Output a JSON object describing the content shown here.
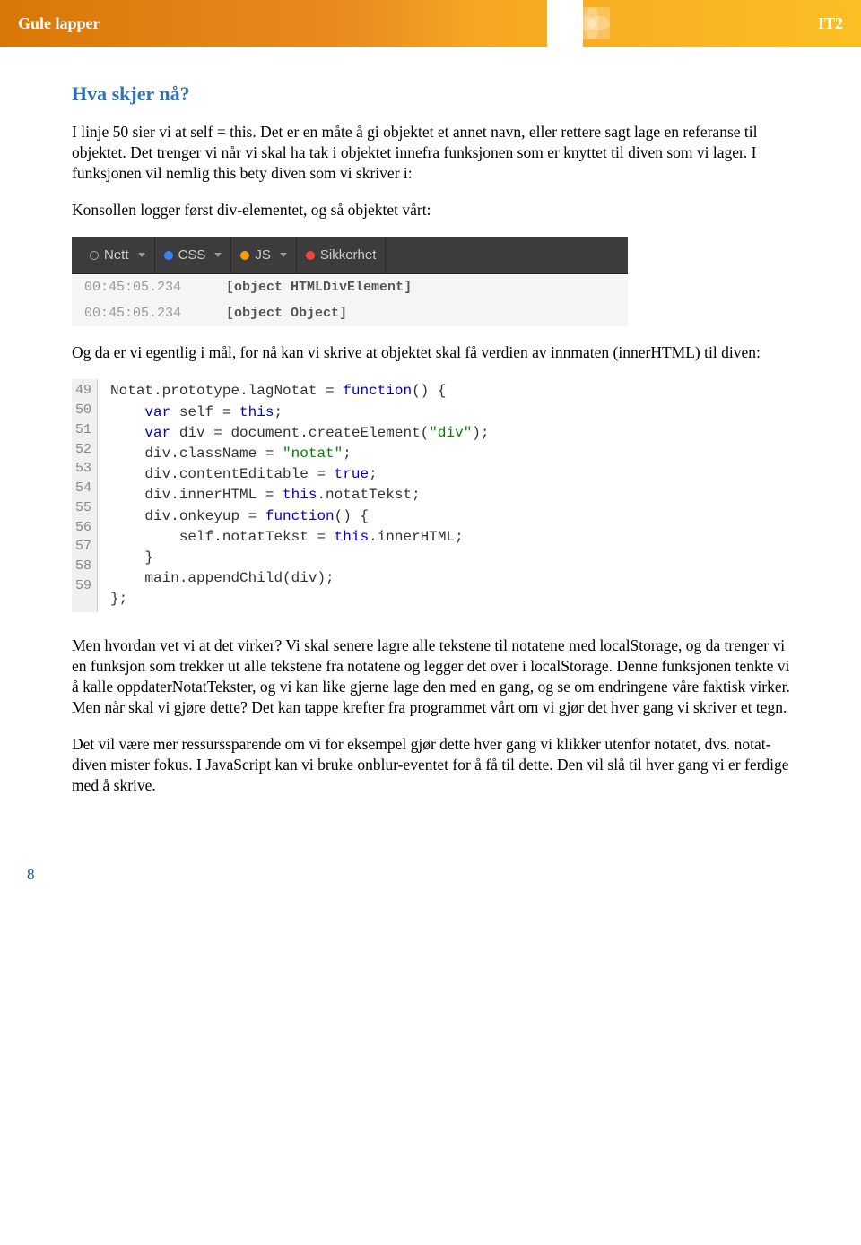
{
  "header": {
    "left": "Gule lapper",
    "right": "IT2"
  },
  "heading": "Hva skjer nå?",
  "para1": "I linje 50 sier vi at self = this. Det er en måte å gi objektet et annet navn, eller rettere sagt lage en referanse til objektet. Det trenger vi når vi skal ha tak i objektet innefra funksjonen som er knyttet til diven som vi lager. I funksjonen vil nemlig this bety diven som vi skriver i:",
  "para2": "Konsollen logger først div-elementet, og så objektet vårt:",
  "console": {
    "tabs": {
      "nett": "Nett",
      "css": "CSS",
      "js": "JS",
      "sikkerhet": "Sikkerhet"
    },
    "rows": [
      {
        "ts": "00:45:05.234",
        "msg": "[object HTMLDivElement]"
      },
      {
        "ts": "00:45:05.234",
        "msg": "[object Object]"
      }
    ]
  },
  "para3": "Og da er vi egentlig i mål, for nå kan vi skrive at objektet skal få verdien av innmaten (innerHTML) til diven:",
  "code": {
    "gutter": "49\n50\n51\n52\n53\n54\n55\n56\n57\n58\n59",
    "l49a": "Notat.prototype.lagNotat = ",
    "l49kw": "function",
    "l49b": "() {",
    "l50kw": "var",
    "l50a": " self = ",
    "l50kw2": "this",
    "l50b": ";",
    "l51kw": "var",
    "l51a": " div = document.createElement(",
    "l51s": "\"div\"",
    "l51b": ");",
    "l52a": "div.className = ",
    "l52s": "\"notat\"",
    "l52b": ";",
    "l53a": "div.contentEditable = ",
    "l53kw": "true",
    "l53b": ";",
    "l54a": "div.innerHTML = ",
    "l54kw": "this",
    "l54b": ".notatTekst;",
    "l55a": "div.onkeyup = ",
    "l55kw": "function",
    "l55b": "() {",
    "l56a": "self.notatTekst = ",
    "l56kw": "this",
    "l56b": ".innerHTML;",
    "l57": "}",
    "l58": "main.appendChild(div);",
    "l59": "};"
  },
  "para4": "Men hvordan vet vi at det virker? Vi skal senere lagre alle tekstene til notatene med localStorage, og da trenger vi en funksjon som trekker ut alle tekstene fra notatene og legger det over i localStorage. Denne funksjonen tenkte vi å kalle oppdaterNotatTekster, og vi kan like gjerne lage den med en gang, og se om endringene våre faktisk virker. Men når skal vi gjøre dette? Det kan tappe krefter fra programmet vårt om vi gjør det hver gang vi skriver et tegn.",
  "para5": "Det vil være mer ressurssparende om vi for eksempel gjør dette hver gang vi klikker utenfor notatet, dvs. notat-diven mister fokus. I JavaScript kan vi bruke onblur-eventet for å få til dette. Den vil slå til hver gang vi er ferdige med å skrive.",
  "pageNum": "8"
}
